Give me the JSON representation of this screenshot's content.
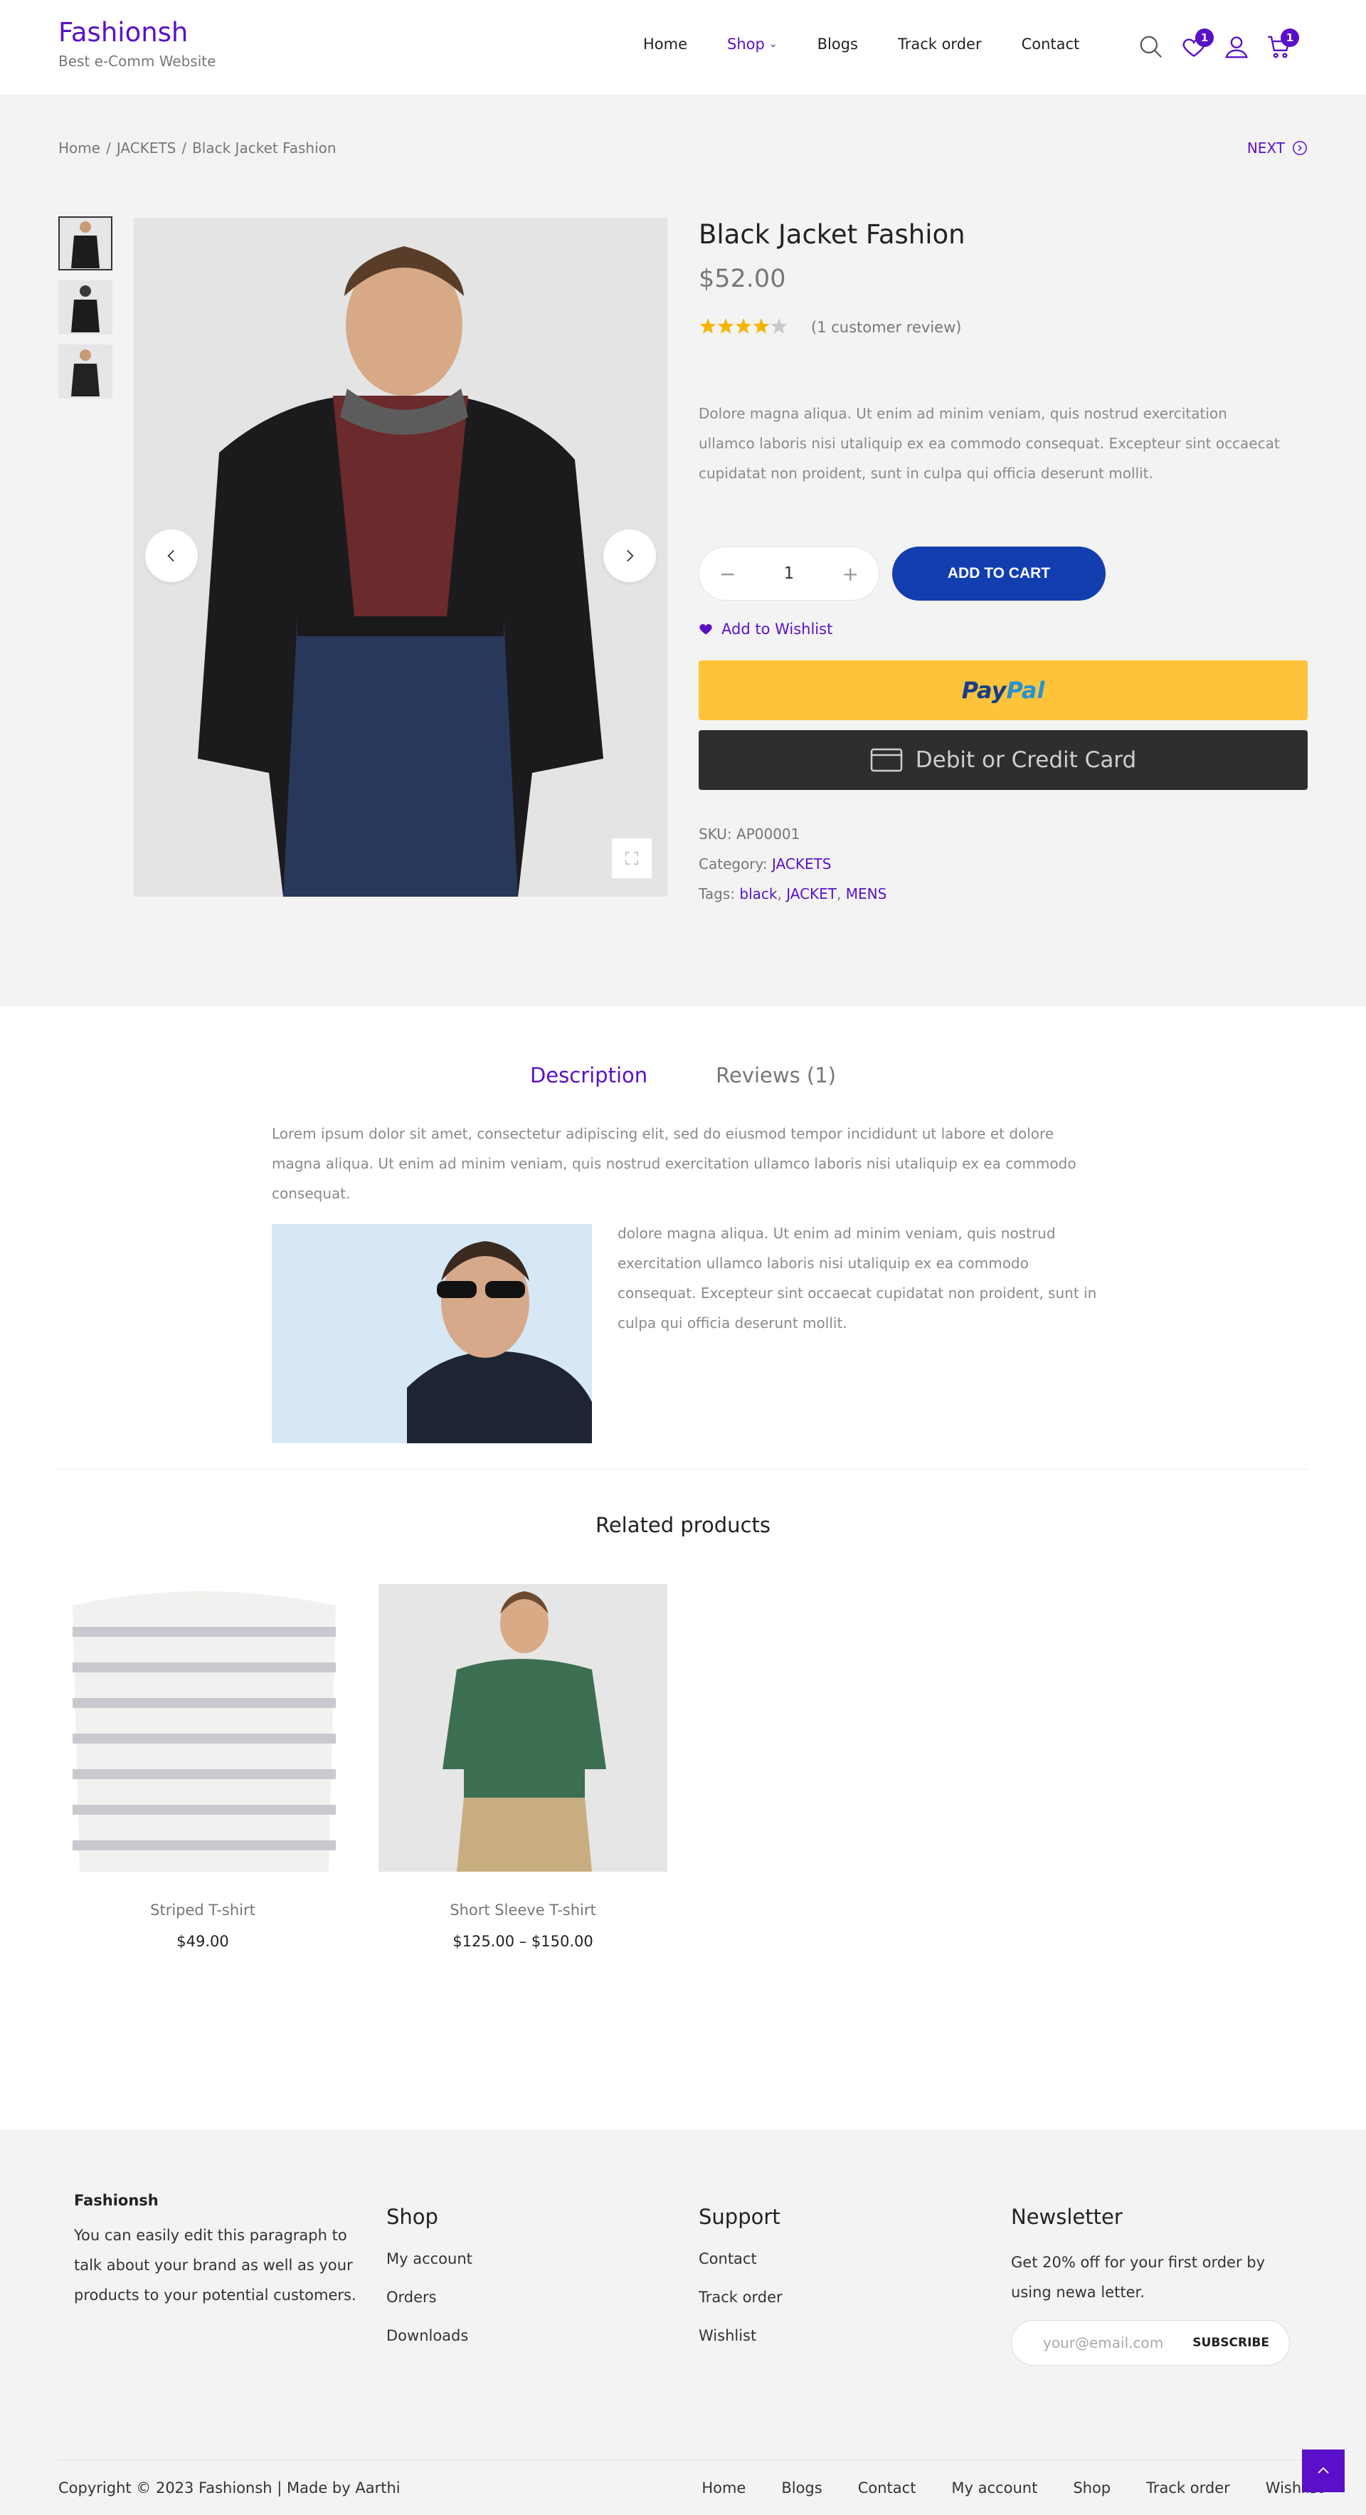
{
  "header": {
    "brand": "Fashionsh",
    "tagline": "Best e-Comm Website",
    "nav": [
      "Home",
      "Shop",
      "Blogs",
      "Track order",
      "Contact"
    ],
    "wishlist_count": "1",
    "cart_count": "1"
  },
  "breadcrumb": [
    "Home",
    "/",
    "JACKETS",
    "/",
    "Black Jacket Fashion"
  ],
  "next_label": "NEXT",
  "product": {
    "title": "Black Jacket Fashion",
    "price": "$52.00",
    "rating": 4,
    "review_link": "(1 customer review)",
    "description": "Dolore magna aliqua. Ut enim ad minim veniam, quis nostrud exercitation ullamco laboris nisi utaliquip ex ea commodo consequat. Excepteur sint occaecat cupidatat non proident, sunt in culpa qui officia deserunt mollit.",
    "quantity": "1",
    "add_to_cart": "ADD TO CART",
    "add_to_wishlist": "Add to Wishlist",
    "paypal_pay": "Pay",
    "paypal_pal": "Pal",
    "card_label": "Debit or Credit Card",
    "sku_label": "SKU:",
    "sku": "AP00001",
    "category_label": "Category:",
    "category": "JACKETS",
    "tags_label": "Tags:",
    "tags": [
      "black",
      "JACKET",
      "MENS"
    ]
  },
  "tabs": [
    "Description",
    "Reviews (1)"
  ],
  "description": {
    "p1": "Lorem ipsum dolor sit amet, consectetur adipiscing elit, sed do eiusmod tempor incididunt ut labore et dolore magna aliqua. Ut enim ad minim veniam, quis nostrud exercitation ullamco laboris nisi utaliquip ex ea commodo consequat.",
    "p2": "dolore magna aliqua. Ut enim ad minim veniam, quis nostrud exercitation ullamco laboris nisi utaliquip ex ea commodo consequat. Excepteur sint occaecat cupidatat non proident, sunt in culpa qui officia deserunt mollit."
  },
  "related": {
    "title": "Related products",
    "items": [
      {
        "name": "Striped T-shirt",
        "price": "$49.00"
      },
      {
        "name": "Short Sleeve T-shirt",
        "price": "$125.00 – $150.00"
      }
    ]
  },
  "footer": {
    "brand": "Fashionsh",
    "about": "You can easily edit this paragraph to talk about your brand as well as your products to your potential customers.",
    "shop_title": "Shop",
    "shop_links": [
      "My account",
      "Orders",
      "Downloads"
    ],
    "support_title": "Support",
    "support_links": [
      "Contact",
      "Track order",
      "Wishlist"
    ],
    "newsletter_title": "Newsletter",
    "newsletter_text": "Get 20% off for your first order by using newa letter.",
    "email_placeholder": "your@email.com",
    "subscribe": "SUBSCRIBE",
    "copyright": "Copyright © 2023 Fashionsh | Made by Aarthi",
    "bottom_nav": [
      "Home",
      "Blogs",
      "Contact",
      "My account",
      "Shop",
      "Track order",
      "Wishlist"
    ]
  },
  "colors": {
    "accent": "#5a10c8",
    "cart_button": "#123eb0",
    "paypal": "#fec33a",
    "card_button": "#2c2e2f"
  }
}
